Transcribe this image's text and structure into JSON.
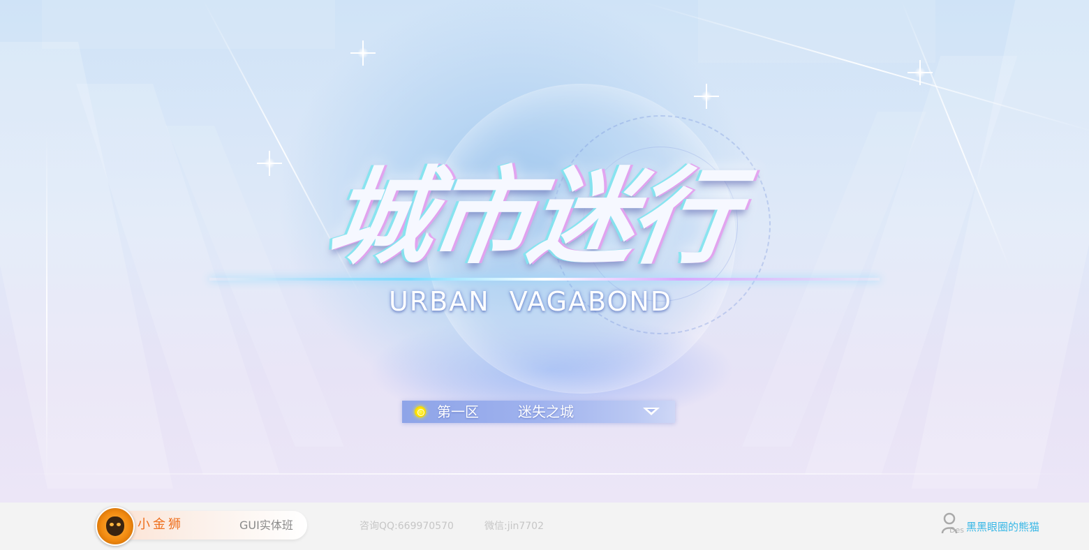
{
  "game": {
    "title_zh": "城市迷行",
    "title_en": "URBAN VAGABOND"
  },
  "server_select": {
    "zone": "第一区",
    "server_name": "迷失之城",
    "status_color": "#ffe100"
  },
  "footer": {
    "brand_name": "小金狮",
    "course": "GUI实体班",
    "qq": "咨询QQ:669970570",
    "wechat": "微信:jin7702",
    "author_tag": "Des",
    "author_name": "黑黑眼圈的熊猫"
  },
  "colors": {
    "brand_orange": "#ee6e1c",
    "author_blue": "#38b7e6",
    "select_bar": "#9fb2ee"
  },
  "icons": [
    "lion-logo-icon",
    "status-dot-icon",
    "dropdown-arrow-icon",
    "user-icon"
  ]
}
